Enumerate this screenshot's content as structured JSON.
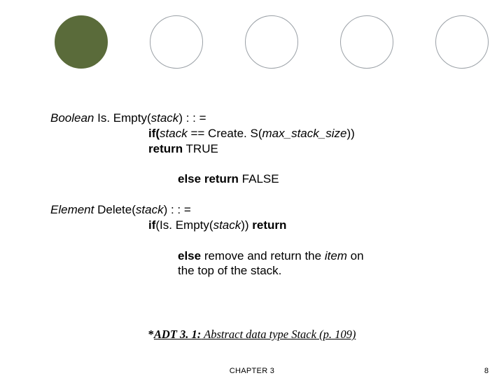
{
  "decl1": {
    "type": "Boolean",
    "name": " Is. Empty(",
    "arg": "stack",
    "tail": ") : : ="
  },
  "line1a": {
    "lead": "if(",
    "arg": "stack",
    "mid": " == Create. S(",
    "param": "max_stack_size",
    "tail": "))"
  },
  "line1b": {
    "kw": "return",
    "val": " TRUE"
  },
  "line1c": {
    "kw1": "else",
    "sp": " ",
    "kw2": "return",
    "val": " FALSE"
  },
  "decl2": {
    "type": "Element",
    "name": " Delete(",
    "arg": "stack",
    "tail": ") : : ="
  },
  "line2a": {
    "kw": "if",
    "open": "(Is. Empty(",
    "arg": "stack",
    "close": ")) ",
    "ret": "return"
  },
  "line2b_pre": "else",
  "line2b_mid": " remove and return the ",
  "line2b_item": "item",
  "line2b_post": " on",
  "line2c": "the top of the stack.",
  "caption": {
    "star": "*",
    "title": "ADT 3. 1:",
    "rest": " Abstract data type Stack (p. 109)"
  },
  "footer": {
    "chapter": "CHAPTER 3",
    "page": "8"
  }
}
